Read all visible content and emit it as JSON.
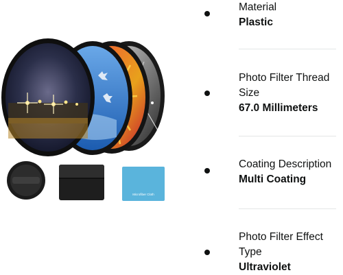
{
  "product_image": {
    "alt": "Camera lens filters kit with lens cap, filter pouch and microfiber cloth",
    "cloth_text": "Microfiber Cloth"
  },
  "specs": [
    {
      "label": "Material",
      "value": "Plastic"
    },
    {
      "label": "Photo Filter Thread Size",
      "value": "67.0 Millimeters"
    },
    {
      "label": "Coating Description",
      "value": "Multi Coating"
    },
    {
      "label": "Photo Filter Effect Type",
      "value": "Ultraviolet"
    }
  ],
  "colors": {
    "text": "#0f1111",
    "divider": "#e3e6e6",
    "cloth": "#5ab4dc"
  }
}
